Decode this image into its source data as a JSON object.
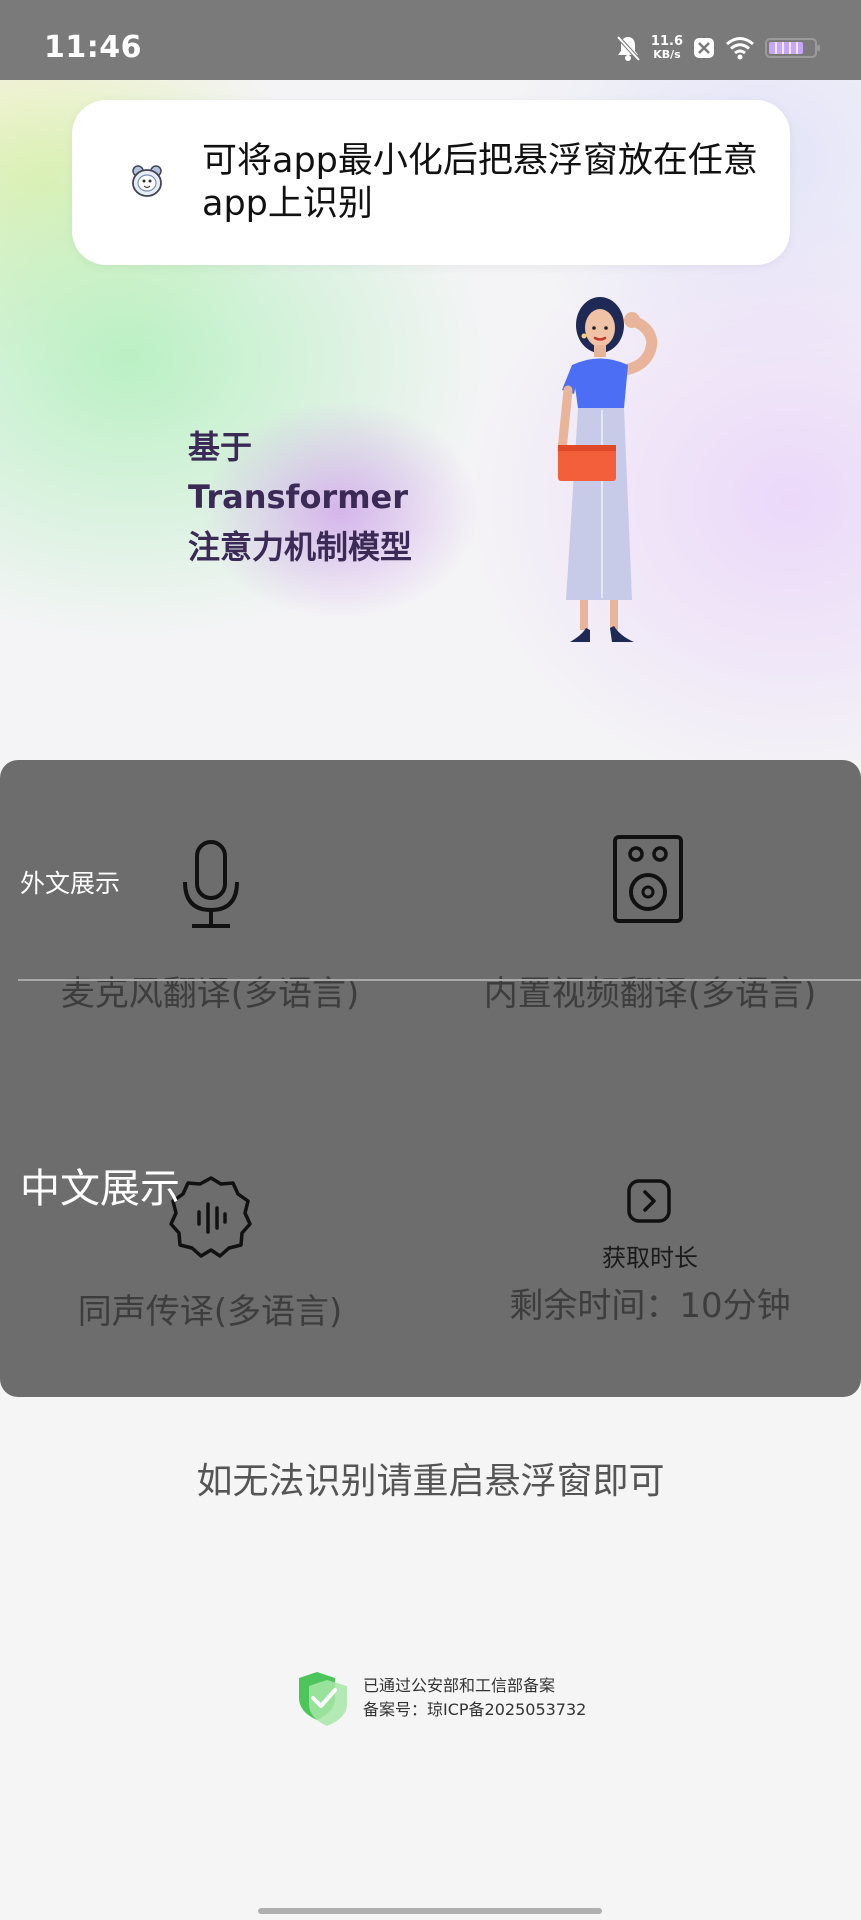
{
  "status_bar": {
    "time": "11:46",
    "net_speed_value": "11.6",
    "net_speed_unit": "KB/s",
    "battery_color": "#c8a6ff"
  },
  "hero": {
    "tip_text": "可将app最小化后把悬浮窗放在任意app上识别",
    "slogan_line1": "基于",
    "slogan_line2": "Transformer",
    "slogan_line3": "注意力机制模型"
  },
  "features": {
    "foreign_display_label": "外文展示",
    "chinese_display_label": "中文展示",
    "mic_translate_label": "麦克风翻译(多语言)",
    "video_translate_label": "内置视频翻译(多语言)",
    "simultaneous_label": "同声传译(多语言)",
    "get_time_label": "获取时长",
    "remaining_time_label": "剩余时间：10分钟"
  },
  "hint": "如无法识别请重启悬浮窗即可",
  "icp": {
    "line1": "已通过公安部和工信部备案",
    "line2": "备案号：琼ICP备2025053732"
  },
  "colors": {
    "panel_bg": "#6d6d6d",
    "slogan": "#3a2a55",
    "shield_green": "#5cc96a"
  }
}
